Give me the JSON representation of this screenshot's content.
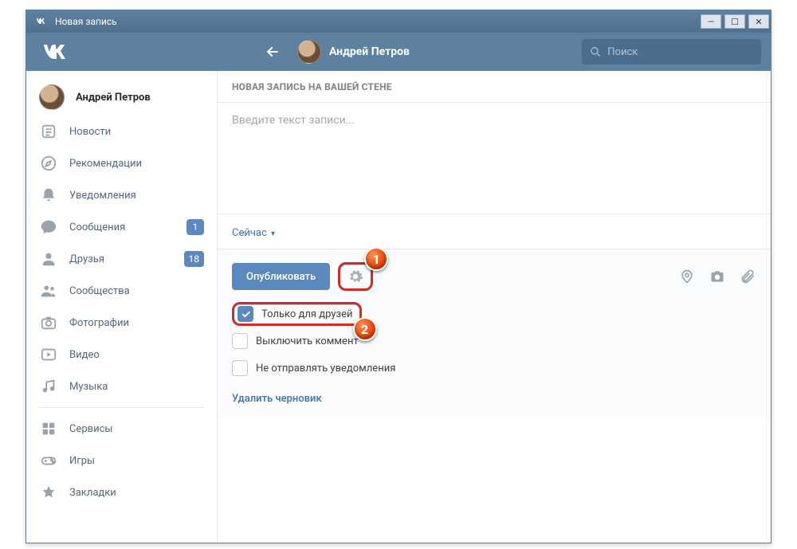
{
  "window": {
    "title": "Новая запись"
  },
  "header": {
    "username": "Андрей Петров",
    "search_placeholder": "Поиск"
  },
  "sidebar": {
    "profile_name": "Андрей Петров",
    "items": [
      {
        "label": "Новости",
        "icon": "news"
      },
      {
        "label": "Рекомендации",
        "icon": "compass"
      },
      {
        "label": "Уведомления",
        "icon": "bell"
      },
      {
        "label": "Сообщения",
        "icon": "chat",
        "badge": "1"
      },
      {
        "label": "Друзья",
        "icon": "user",
        "badge": "18"
      },
      {
        "label": "Сообщества",
        "icon": "users"
      },
      {
        "label": "Фотографии",
        "icon": "camera"
      },
      {
        "label": "Видео",
        "icon": "video"
      },
      {
        "label": "Музыка",
        "icon": "music"
      },
      {
        "label": "Сервисы",
        "icon": "grid"
      },
      {
        "label": "Игры",
        "icon": "gamepad"
      },
      {
        "label": "Закладки",
        "icon": "star"
      }
    ]
  },
  "composer": {
    "header": "НОВАЯ ЗАПИСЬ НА ВАШЕЙ СТЕНЕ",
    "placeholder": "Введите текст записи...",
    "time_label": "Сейчас",
    "publish_label": "Опубликовать",
    "options": {
      "friends_only": "Только для друзей",
      "disable_comments": "Выключить коммент",
      "no_notify": "Не отправлять уведомления"
    },
    "delete_draft": "Удалить черновик"
  },
  "annotations": {
    "marker1": "1",
    "marker2": "2"
  },
  "colors": {
    "accent": "#5b88bd",
    "highlight": "#d02a2a",
    "header_bg": "#5e80a1"
  }
}
